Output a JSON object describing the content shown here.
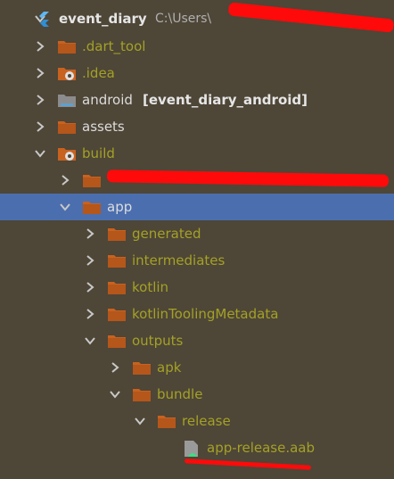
{
  "root": {
    "name": "event_diary",
    "path": "C:\\Users\\"
  },
  "items": [
    {
      "label": ".dart_tool",
      "icon": "folder-icon",
      "expanded": false
    },
    {
      "label": ".idea",
      "icon": "settings-folder-icon",
      "expanded": false
    },
    {
      "label": "android",
      "module": "[event_diary_android]",
      "icon": "module-folder-icon",
      "expanded": false
    },
    {
      "label": "assets",
      "icon": "folder-icon",
      "expanded": false
    },
    {
      "label": "build",
      "icon": "settings-folder-icon",
      "expanded": true
    },
    {
      "label": "",
      "icon": "folder-icon",
      "expanded": false
    },
    {
      "label": "app",
      "icon": "folder-icon",
      "expanded": true
    },
    {
      "label": "generated",
      "icon": "folder-icon",
      "expanded": false
    },
    {
      "label": "intermediates",
      "icon": "folder-icon",
      "expanded": false
    },
    {
      "label": "kotlin",
      "icon": "folder-icon",
      "expanded": false
    },
    {
      "label": "kotlinToolingMetadata",
      "icon": "folder-icon",
      "expanded": false
    },
    {
      "label": "outputs",
      "icon": "folder-icon",
      "expanded": true
    },
    {
      "label": "apk",
      "icon": "folder-icon",
      "expanded": false
    },
    {
      "label": "bundle",
      "icon": "folder-icon",
      "expanded": true
    },
    {
      "label": "release",
      "icon": "folder-icon",
      "expanded": true
    },
    {
      "label": "app-release.aab",
      "icon": "android-bundle-file-icon"
    }
  ],
  "colors": {
    "background": "#4e4637",
    "selection": "#4b6eaf",
    "folder": "#c8621f",
    "excluded_text": "#a4a126",
    "redaction": "#ff0a0a"
  }
}
